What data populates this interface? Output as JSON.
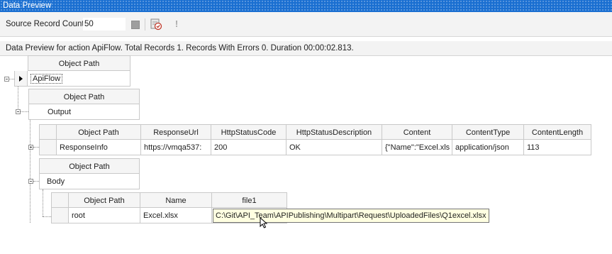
{
  "window": {
    "title": "Data Preview"
  },
  "toolbar": {
    "record_count_label": "Source Record Count",
    "record_count_value": "50",
    "icons": [
      "stop-icon",
      "check-list-icon",
      "exclamation-icon"
    ]
  },
  "status_text": "Data Preview for action ApiFlow. Total Records 1. Records With Errors 0. Duration 00:00:02.813.",
  "level1": {
    "header": "Object Path",
    "value": "ApiFlow"
  },
  "level2": {
    "header": "Object Path",
    "value": "Output"
  },
  "response_info": {
    "headers": [
      "Object Path",
      "ResponseUrl",
      "HttpStatusCode",
      "HttpStatusDescription",
      "Content",
      "ContentType",
      "ContentLength"
    ],
    "row": [
      "ResponseInfo",
      "https://vmqa537:",
      "200",
      "OK",
      "{\"Name\":\"Excel.xls",
      "application/json",
      "113"
    ]
  },
  "body": {
    "header": "Object Path",
    "value": "Body"
  },
  "root_table": {
    "headers": [
      "Object Path",
      "Name",
      "file1"
    ],
    "row": [
      "root",
      "Excel.xlsx",
      ""
    ]
  },
  "tooltip": "C:\\Git\\API_Team\\APIPublishing\\Multipart\\Request\\UploadedFiles\\Q1excel.xlsx",
  "colors": {
    "title_bar": "#1a6fd1",
    "tooltip_bg": "#ffffe1"
  }
}
